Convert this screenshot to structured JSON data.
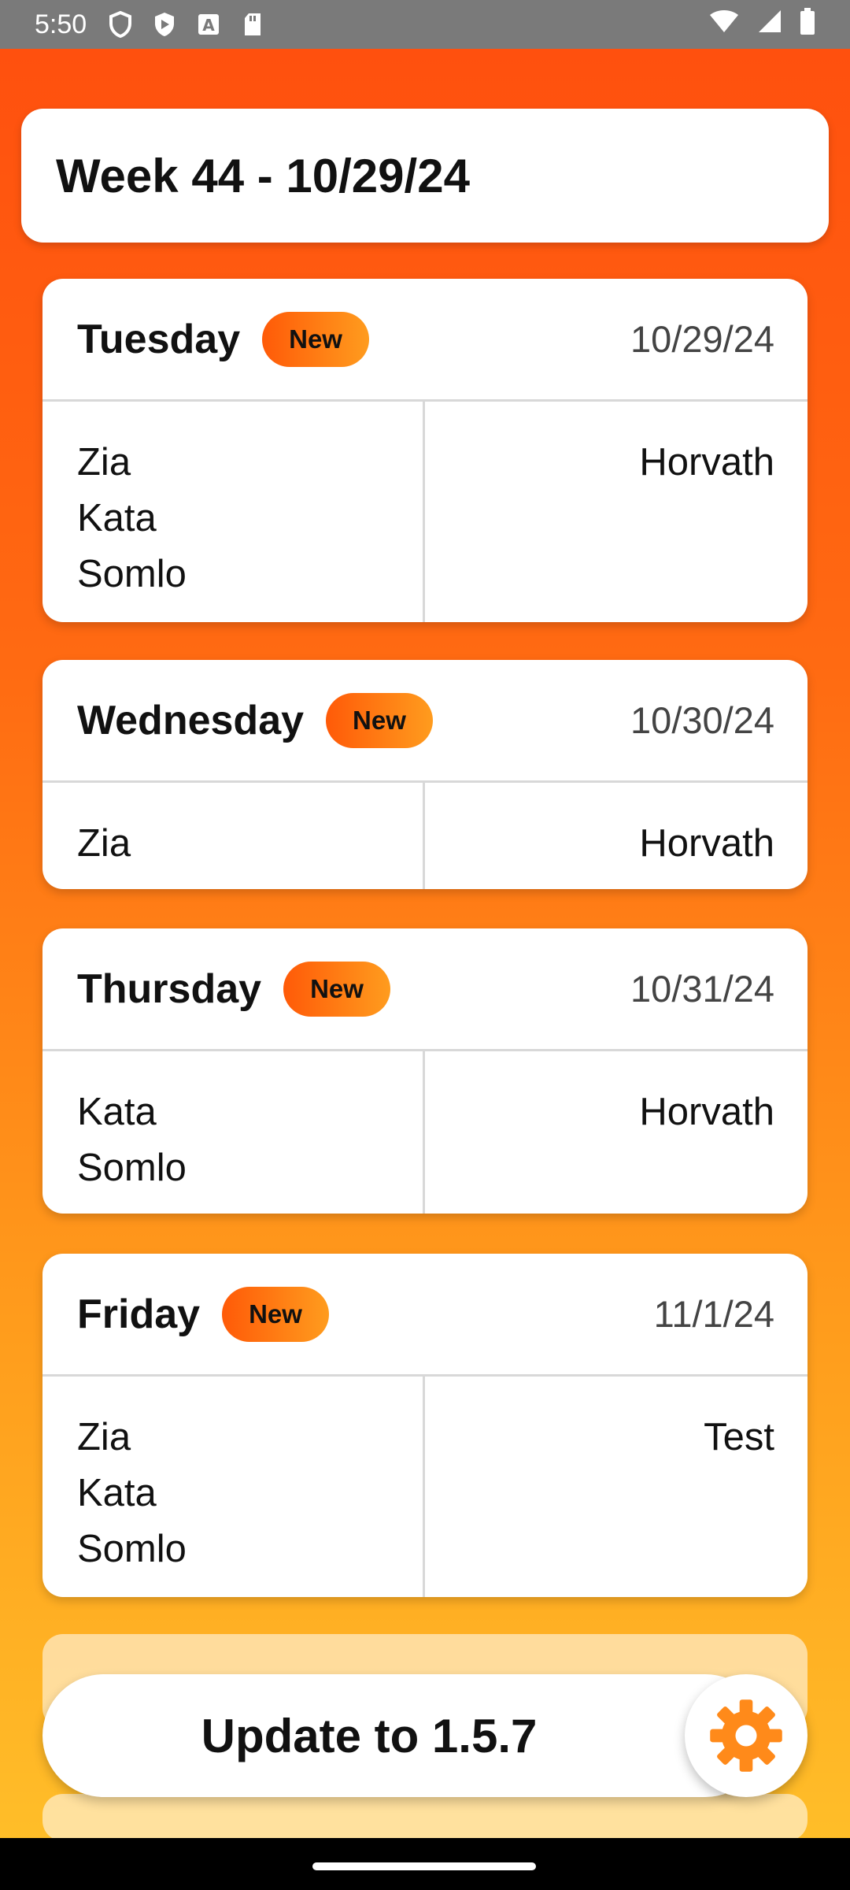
{
  "status_bar": {
    "time": "5:50",
    "icons": [
      "shield-icon",
      "play-store-icon",
      "font-icon",
      "sd-card-icon"
    ],
    "right_icons": [
      "wifi-icon",
      "signal-icon",
      "battery-icon"
    ]
  },
  "header": {
    "title": "Week 44 - 10/29/24"
  },
  "days": [
    {
      "name": "Tuesday",
      "badge": "New",
      "date": "10/29/24",
      "left": [
        "Zia",
        "Kata",
        "Somlo"
      ],
      "right": [
        "Horvath"
      ]
    },
    {
      "name": "Wednesday",
      "badge": "New",
      "date": "10/30/24",
      "left": [
        "Zia"
      ],
      "right": [
        "Horvath"
      ]
    },
    {
      "name": "Thursday",
      "badge": "New",
      "date": "10/31/24",
      "left": [
        "Kata",
        "Somlo"
      ],
      "right": [
        "Horvath"
      ]
    },
    {
      "name": "Friday",
      "badge": "New",
      "date": "11/1/24",
      "left": [
        "Zia",
        "Kata",
        "Somlo"
      ],
      "right": [
        "Test"
      ]
    }
  ],
  "update_button": {
    "label": "Update to 1.5.7"
  },
  "settings_button": {
    "icon": "gear-icon",
    "color": "#ff8a1a"
  },
  "colors": {
    "accent_start": "#ff4e0e",
    "accent_end": "#ffc12a",
    "badge_start": "#ff5a08",
    "badge_end": "#ff9c1e"
  }
}
